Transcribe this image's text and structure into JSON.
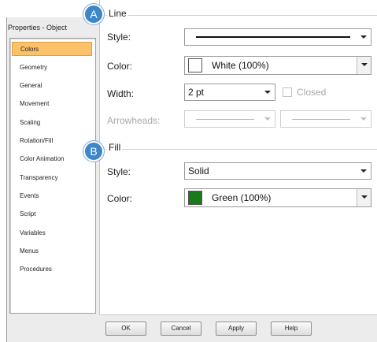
{
  "window": {
    "title": "Properties - Object"
  },
  "sidebar": {
    "items": [
      {
        "label": "Colors"
      },
      {
        "label": "Geometry"
      },
      {
        "label": "General"
      },
      {
        "label": "Movement"
      },
      {
        "label": "Scaling"
      },
      {
        "label": "Rotation/Fill"
      },
      {
        "label": "Color Animation"
      },
      {
        "label": "Transparency"
      },
      {
        "label": "Events"
      },
      {
        "label": "Script"
      },
      {
        "label": "Variables"
      },
      {
        "label": "Menus"
      },
      {
        "label": "Procedures"
      }
    ],
    "selected": "Colors"
  },
  "line_group": {
    "badge": "A",
    "title": "Line",
    "style_label": "Style:",
    "color_label": "Color:",
    "color_value": "White (100%)",
    "color_swatch": "#ffffff",
    "width_label": "Width:",
    "width_value": "2 pt",
    "closed_label": "Closed",
    "arrowheads_label": "Arrowheads:"
  },
  "fill_group": {
    "badge": "B",
    "title": "Fill",
    "style_label": "Style:",
    "style_value": "Solid",
    "color_label": "Color:",
    "color_value": "Green (100%)",
    "color_swatch": "#1a7a1a"
  },
  "buttons": {
    "ok": "OK",
    "cancel": "Cancel",
    "apply": "Apply",
    "help": "Help"
  },
  "colors": {
    "accent_badge": "#3e86c8",
    "selected_item": "#fbc26a"
  }
}
